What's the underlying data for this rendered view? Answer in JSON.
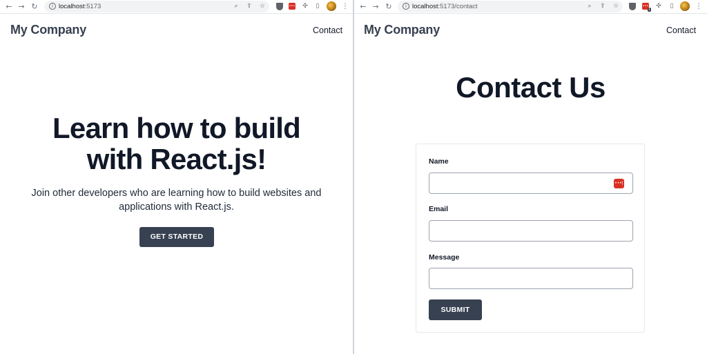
{
  "left_window": {
    "browser": {
      "url_host": "localhost",
      "url_path": ":5173"
    },
    "header": {
      "brand": "My Company",
      "nav_link": "Contact"
    },
    "hero": {
      "title_line1": "Learn how to build",
      "title_line2": "with React.js!",
      "subtitle_line1": "Join other developers who are learning how to build websites and",
      "subtitle_line2": "applications with React.js.",
      "cta_label": "GET STARTED"
    }
  },
  "right_window": {
    "browser": {
      "url_host": "localhost",
      "url_path": ":5173/contact",
      "extension_badge": "1"
    },
    "header": {
      "brand": "My Company",
      "nav_link": "Contact"
    },
    "contact": {
      "title": "Contact Us",
      "fields": [
        {
          "label": "Name",
          "value": ""
        },
        {
          "label": "Email",
          "value": ""
        },
        {
          "label": "Message",
          "value": ""
        }
      ],
      "submit_label": "SUBMIT"
    }
  },
  "colors": {
    "brand_text": "#374151",
    "button_bg": "#374151",
    "password_manager": "#d93025"
  }
}
